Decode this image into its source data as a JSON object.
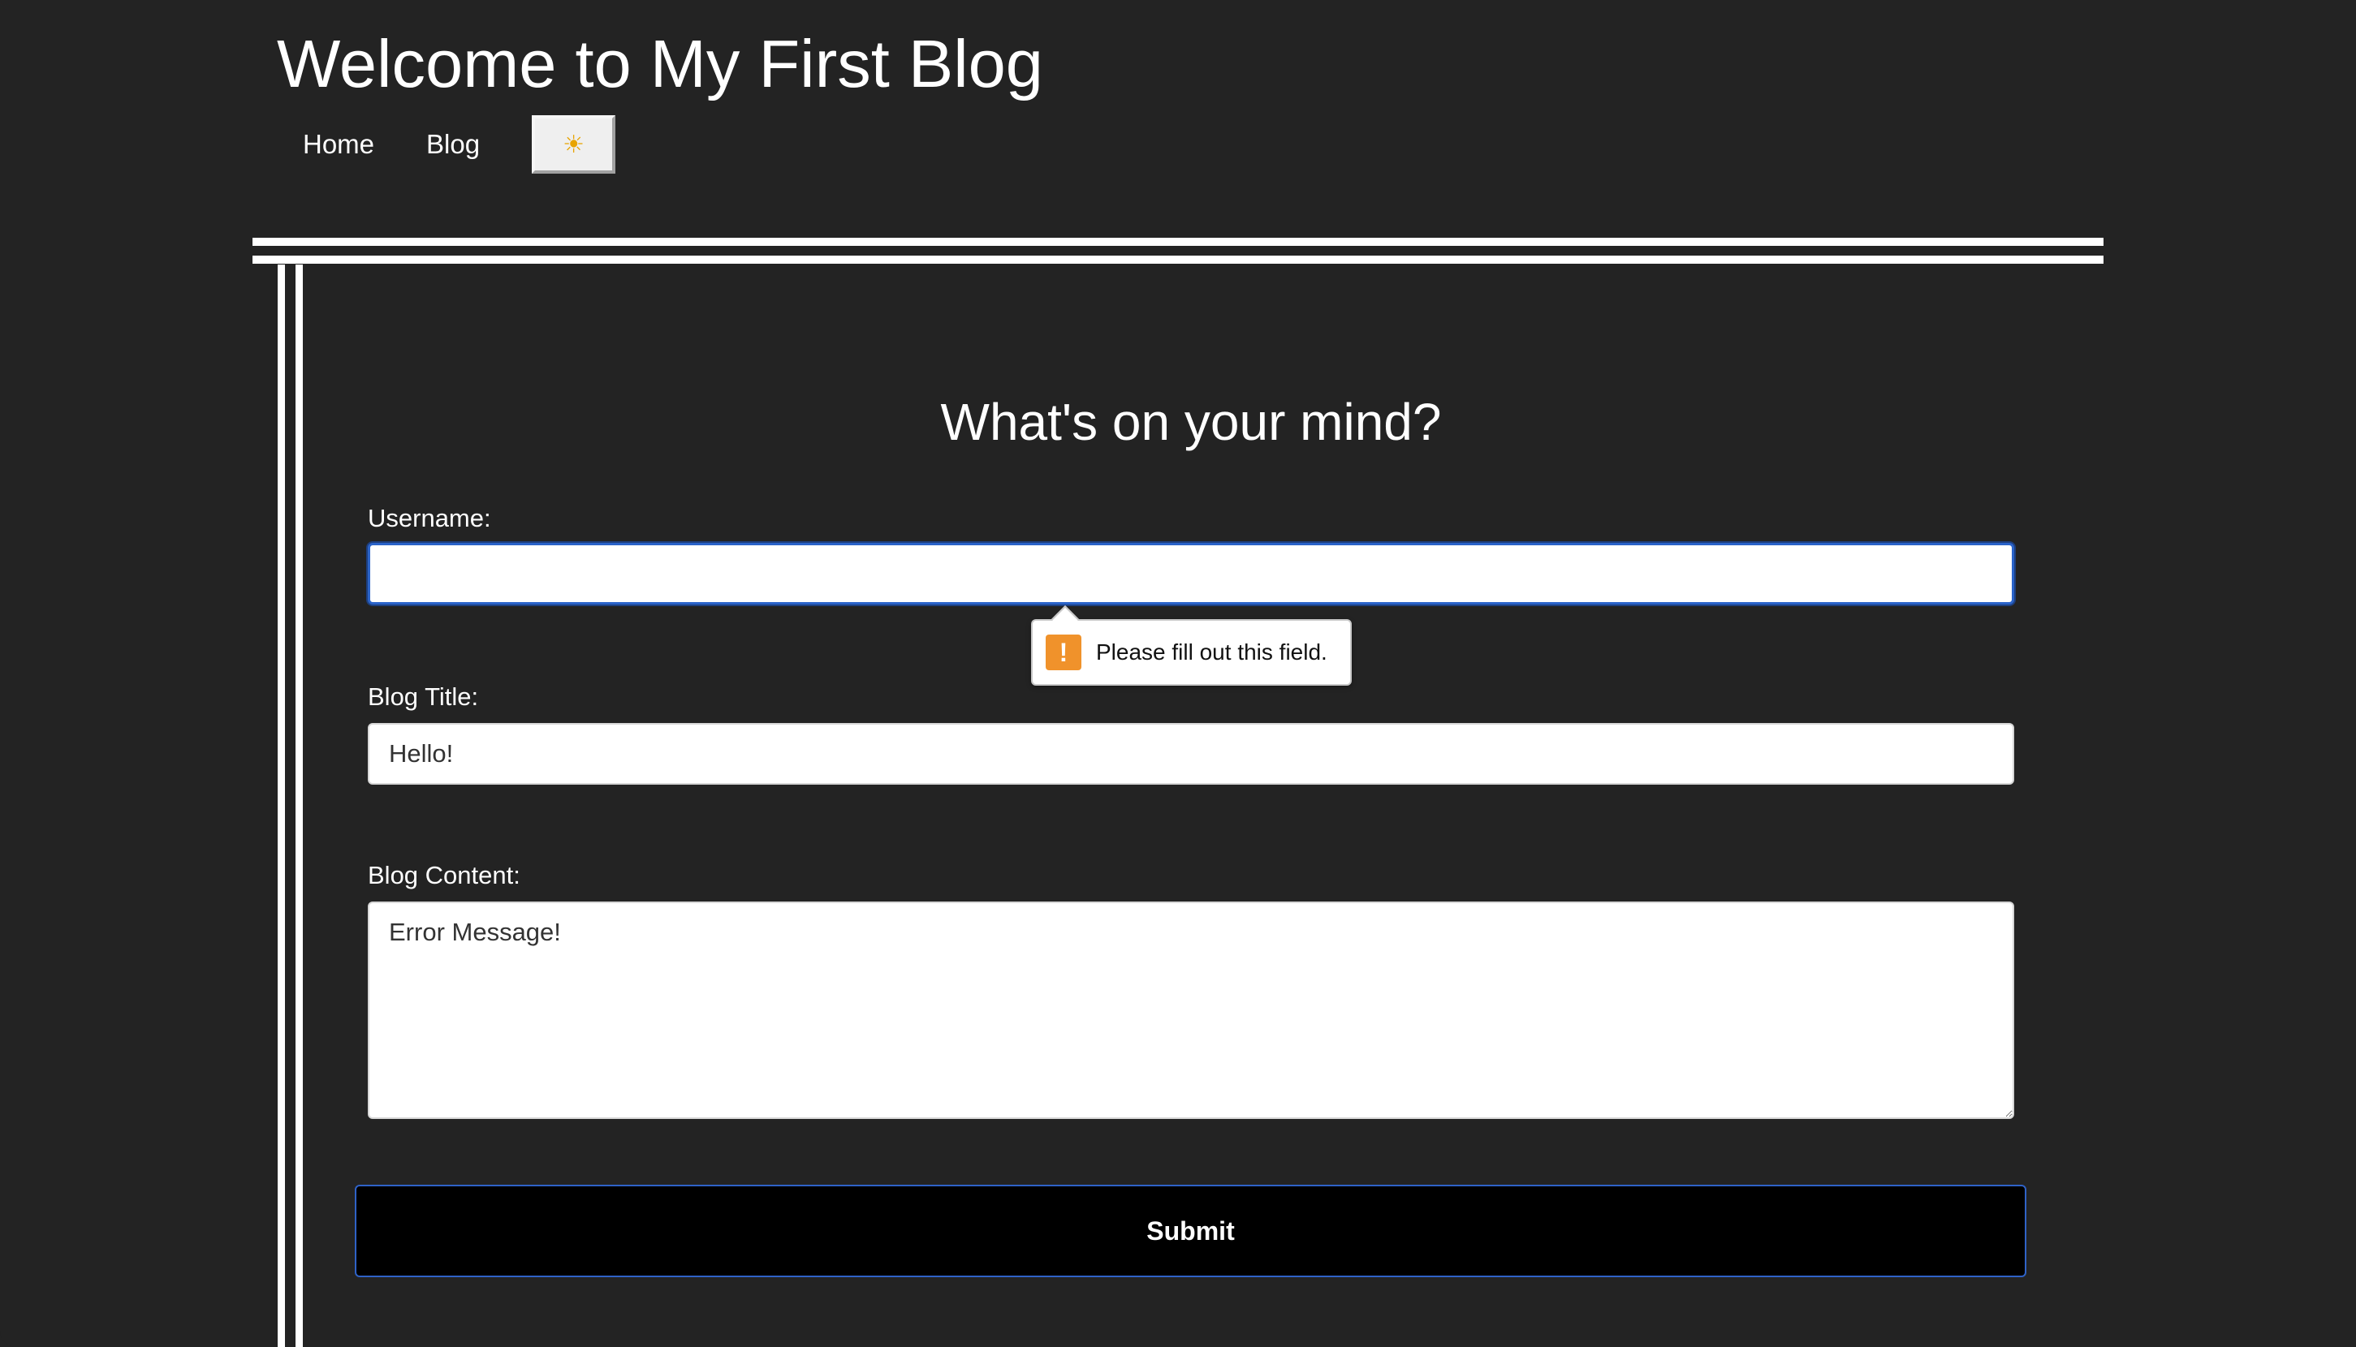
{
  "site": {
    "title": "Welcome to My First Blog"
  },
  "nav": {
    "items": [
      {
        "label": "Home"
      },
      {
        "label": "Blog"
      }
    ],
    "theme_toggle_icon": "sun-icon",
    "theme_toggle_glyph": "☀"
  },
  "form": {
    "heading": "What's on your mind?",
    "username": {
      "label": "Username:",
      "value": ""
    },
    "blog_title": {
      "label": "Blog Title:",
      "value": "Hello!"
    },
    "blog_content": {
      "label": "Blog Content:",
      "value": "Error Message!"
    },
    "submit_label": "Submit"
  },
  "validation": {
    "message": "Please fill out this field.",
    "icon": "warning-icon",
    "icon_glyph": "!"
  },
  "colors": {
    "background": "#232323",
    "focus_ring": "#2a63c9",
    "warning": "#f0922b",
    "submit_background": "#000000"
  }
}
